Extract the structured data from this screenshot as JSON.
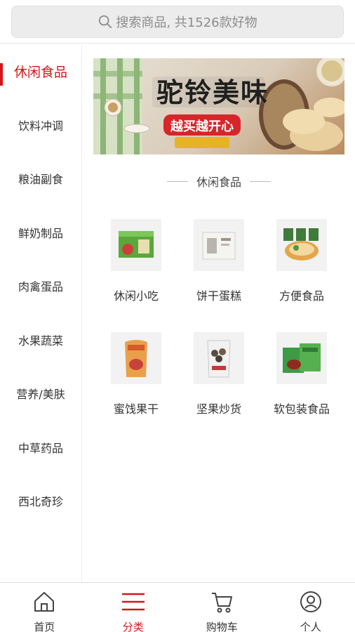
{
  "search": {
    "placeholder": "搜索商品, 共1526款好物",
    "icon": "search-icon"
  },
  "sidebar": {
    "items": [
      {
        "label": "休闲食品",
        "active": true
      },
      {
        "label": "饮料冲调"
      },
      {
        "label": "粮油副食"
      },
      {
        "label": "鲜奶制品"
      },
      {
        "label": "肉禽蛋品"
      },
      {
        "label": "水果蔬菜"
      },
      {
        "label": "营养/美肤"
      },
      {
        "label": "中草药品"
      },
      {
        "label": "西北奇珍"
      }
    ]
  },
  "banner": {
    "title": "驼铃美味",
    "subtitle": "越买越开心"
  },
  "section": {
    "title": "休闲食品"
  },
  "subcategories": [
    {
      "label": "休闲小吃"
    },
    {
      "label": "饼干蛋糕"
    },
    {
      "label": "方便食品"
    },
    {
      "label": "蜜饯果干"
    },
    {
      "label": "坚果炒货"
    },
    {
      "label": "软包装食品"
    }
  ],
  "tabbar": {
    "items": [
      {
        "label": "首页",
        "icon": "home-icon"
      },
      {
        "label": "分类",
        "icon": "category-list-icon",
        "active": true
      },
      {
        "label": "购物车",
        "icon": "cart-icon"
      },
      {
        "label": "个人",
        "icon": "user-icon"
      }
    ]
  },
  "colors": {
    "accent": "#d4161b",
    "search_bg": "#ececec"
  }
}
